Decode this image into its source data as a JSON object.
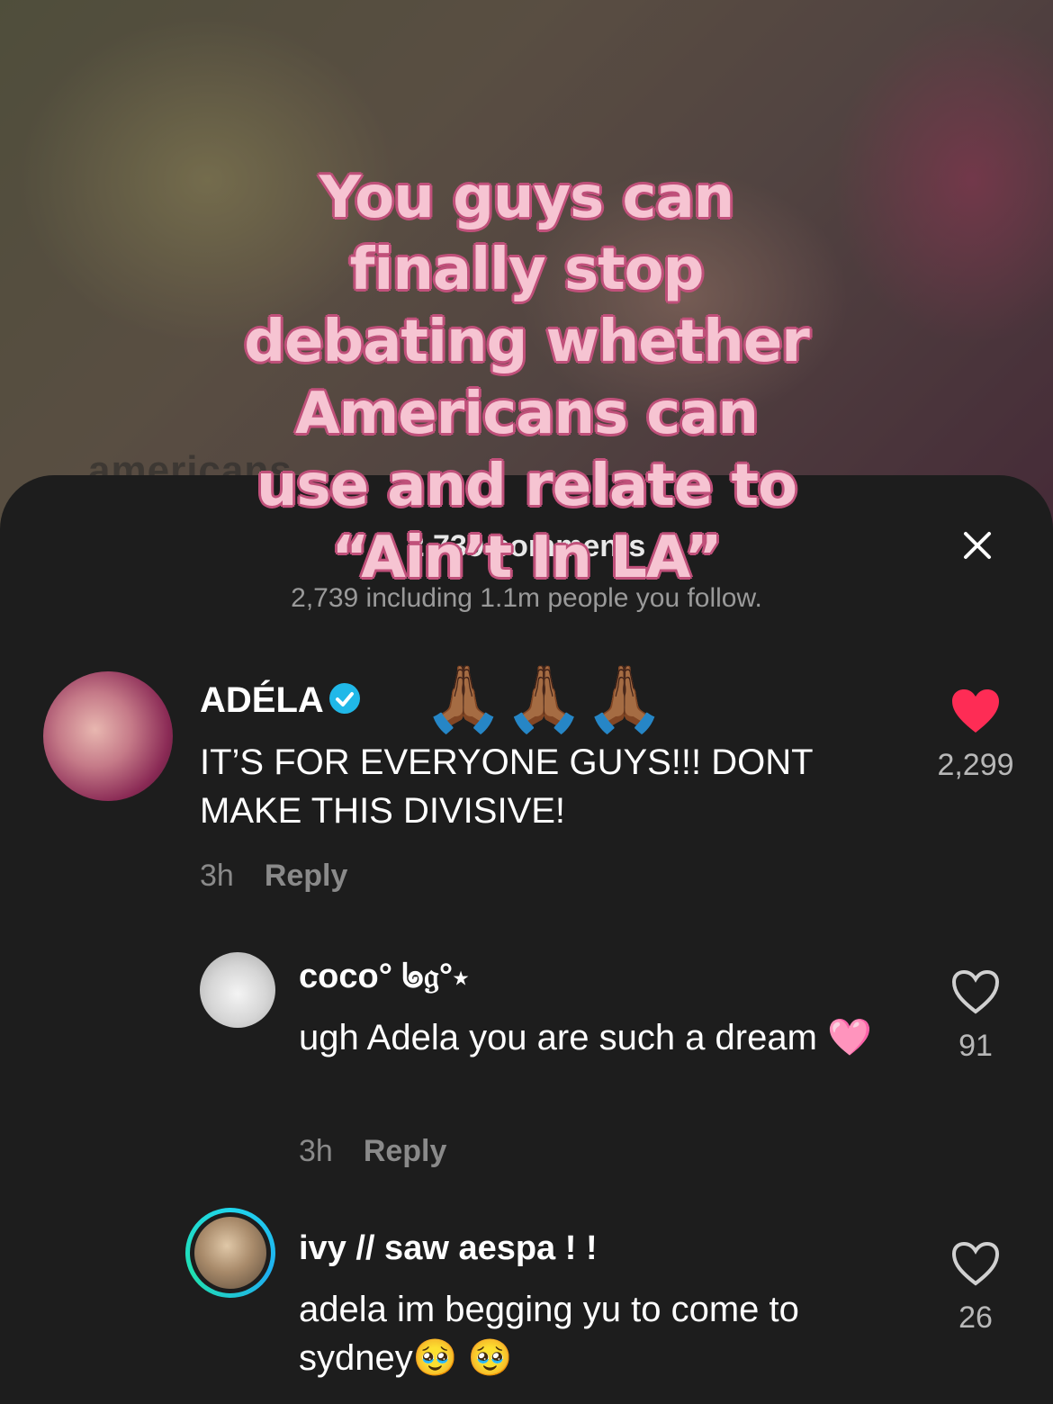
{
  "background": {
    "faded_text": "americans"
  },
  "overlay": {
    "caption_lines": [
      "You guys can",
      "finally stop",
      "debating whether",
      "Americans can",
      "use and relate to",
      "“Ain’t In LA”"
    ],
    "caption_emoji": "🙏🏾🙏🏾🙏🏾"
  },
  "sheet": {
    "title": "2,739 comments",
    "subtitle": "2,739 including 1.1m people you follow.",
    "close_icon": "close-icon"
  },
  "comments": [
    {
      "name": "ADÉLA",
      "verified": true,
      "text": "IT’S FOR EVERYONE GUYS!!! DONT MAKE THIS DIVISIVE!",
      "time": "3h",
      "reply_label": "Reply",
      "likes": "2,299",
      "liked": true,
      "colors": {
        "heart": "#fe2c55"
      }
    },
    {
      "name": "coco° ᖚ𝔤°⋆",
      "text": "ugh Adela you are such a dream 🩷",
      "time": "3h",
      "reply_label": "Reply",
      "likes": "91",
      "liked": false
    },
    {
      "name": "ivy // saw aespa ! !",
      "text": "adela im begging yu to come to sydney🥹 🥹",
      "likes": "26",
      "liked": false,
      "story_ring": true
    }
  ]
}
